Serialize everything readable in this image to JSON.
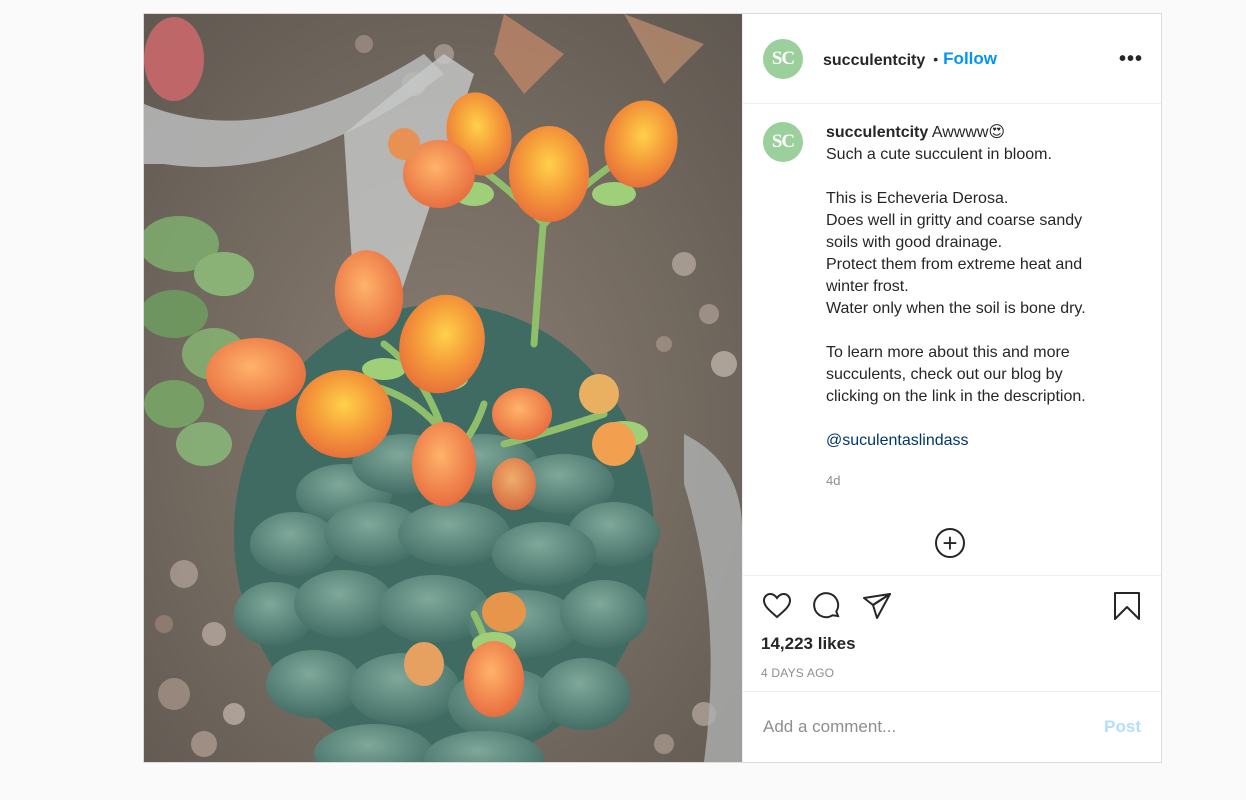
{
  "header": {
    "avatar_text": "SC",
    "username": "succulentcity",
    "separator": "•",
    "follow_label": "Follow",
    "more_label": "•••"
  },
  "caption": {
    "avatar_text": "SC",
    "username": "succulentcity",
    "first_line": "Awwww😍",
    "lines": [
      "Such a cute succulent in bloom.",
      "",
      "This is Echeveria Derosa.",
      "Does well in gritty and coarse sandy",
      "soils with good drainage.",
      "Protect them from extreme heat and",
      "winter frost.",
      "Water only when the soil is bone dry.",
      "",
      "To learn more about this and more",
      "succulents, check out our blog by",
      "clicking on the link in the description.",
      ""
    ],
    "mention": "@suculentaslindass",
    "time": "4d"
  },
  "load_more_label": "+",
  "actions": {
    "like_icon": "heart-icon",
    "comment_icon": "comment-icon",
    "share_icon": "paper-plane-icon",
    "save_icon": "bookmark-icon",
    "likes": "14,223 likes",
    "posted_ago": "4 DAYS AGO"
  },
  "comment_box": {
    "placeholder": "Add a comment...",
    "post_label": "Post"
  },
  "colors": {
    "follow": "#0095f6",
    "post_disabled": "#b2dffc",
    "avatar_bg": "#9bcf9c",
    "mention": "#00376b"
  }
}
